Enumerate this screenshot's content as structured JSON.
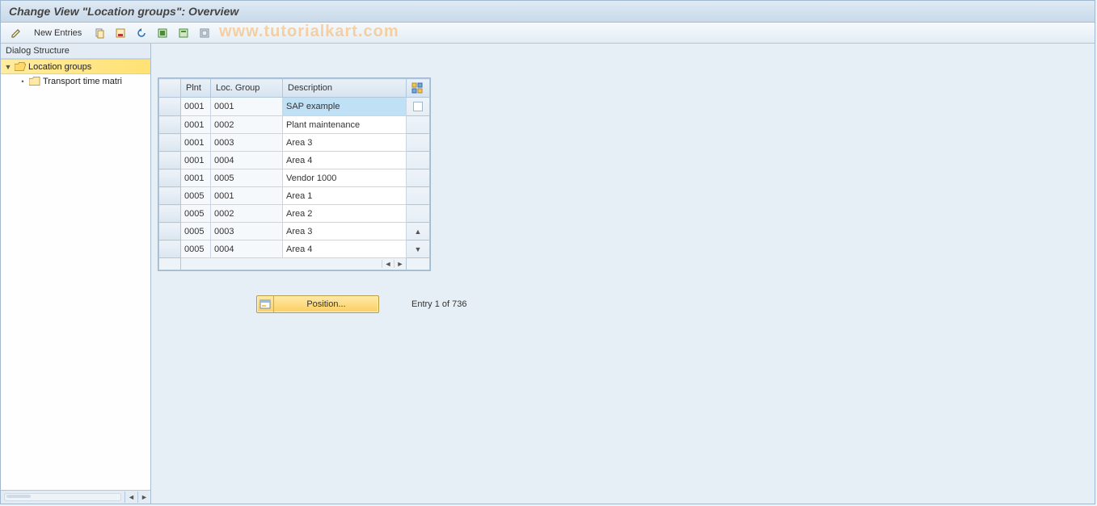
{
  "title": "Change View \"Location groups\": Overview",
  "watermark": "www.tutorialkart.com",
  "toolbar": {
    "new_entries": "New Entries"
  },
  "dialog_structure": {
    "header": "Dialog Structure",
    "root": "Location groups",
    "child": "Transport time matri"
  },
  "table": {
    "columns": {
      "plnt": "Plnt",
      "loc_group": "Loc. Group",
      "desc": "Description"
    },
    "rows": [
      {
        "plnt": "0001",
        "loc": "0001",
        "desc": "SAP example",
        "selected": true
      },
      {
        "plnt": "0001",
        "loc": "0002",
        "desc": "Plant maintenance"
      },
      {
        "plnt": "0001",
        "loc": "0003",
        "desc": "Area 3"
      },
      {
        "plnt": "0001",
        "loc": "0004",
        "desc": "Area 4"
      },
      {
        "plnt": "0001",
        "loc": "0005",
        "desc": "Vendor 1000"
      },
      {
        "plnt": "0005",
        "loc": "0001",
        "desc": "Area 1"
      },
      {
        "plnt": "0005",
        "loc": "0002",
        "desc": "Area 2"
      },
      {
        "plnt": "0005",
        "loc": "0003",
        "desc": "Area 3"
      },
      {
        "plnt": "0005",
        "loc": "0004",
        "desc": "Area 4"
      }
    ]
  },
  "position_button": "Position...",
  "entry_status": "Entry 1 of 736"
}
